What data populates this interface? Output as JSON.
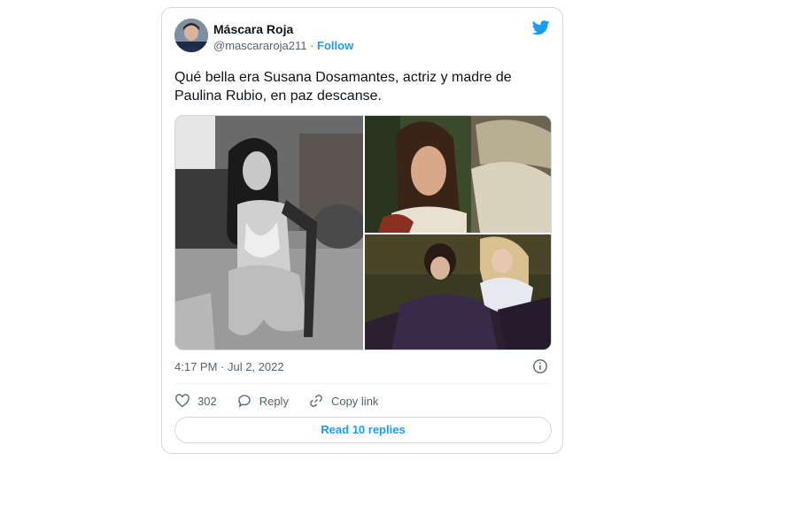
{
  "tweet": {
    "author_name": "Máscara Roja",
    "handle": "@mascararoja211",
    "separator": "·",
    "follow_label": "Follow",
    "text": "Qué bella era Susana Dosamantes, actriz y madre de Paulina Rubio, en paz descanse.",
    "timestamp": "4:17 PM · Jul 2, 2022",
    "likes_count": "302",
    "reply_label": "Reply",
    "copy_link_label": "Copy link",
    "read_replies_label": "Read 10 replies",
    "accent_color": "#1d9bf0"
  }
}
